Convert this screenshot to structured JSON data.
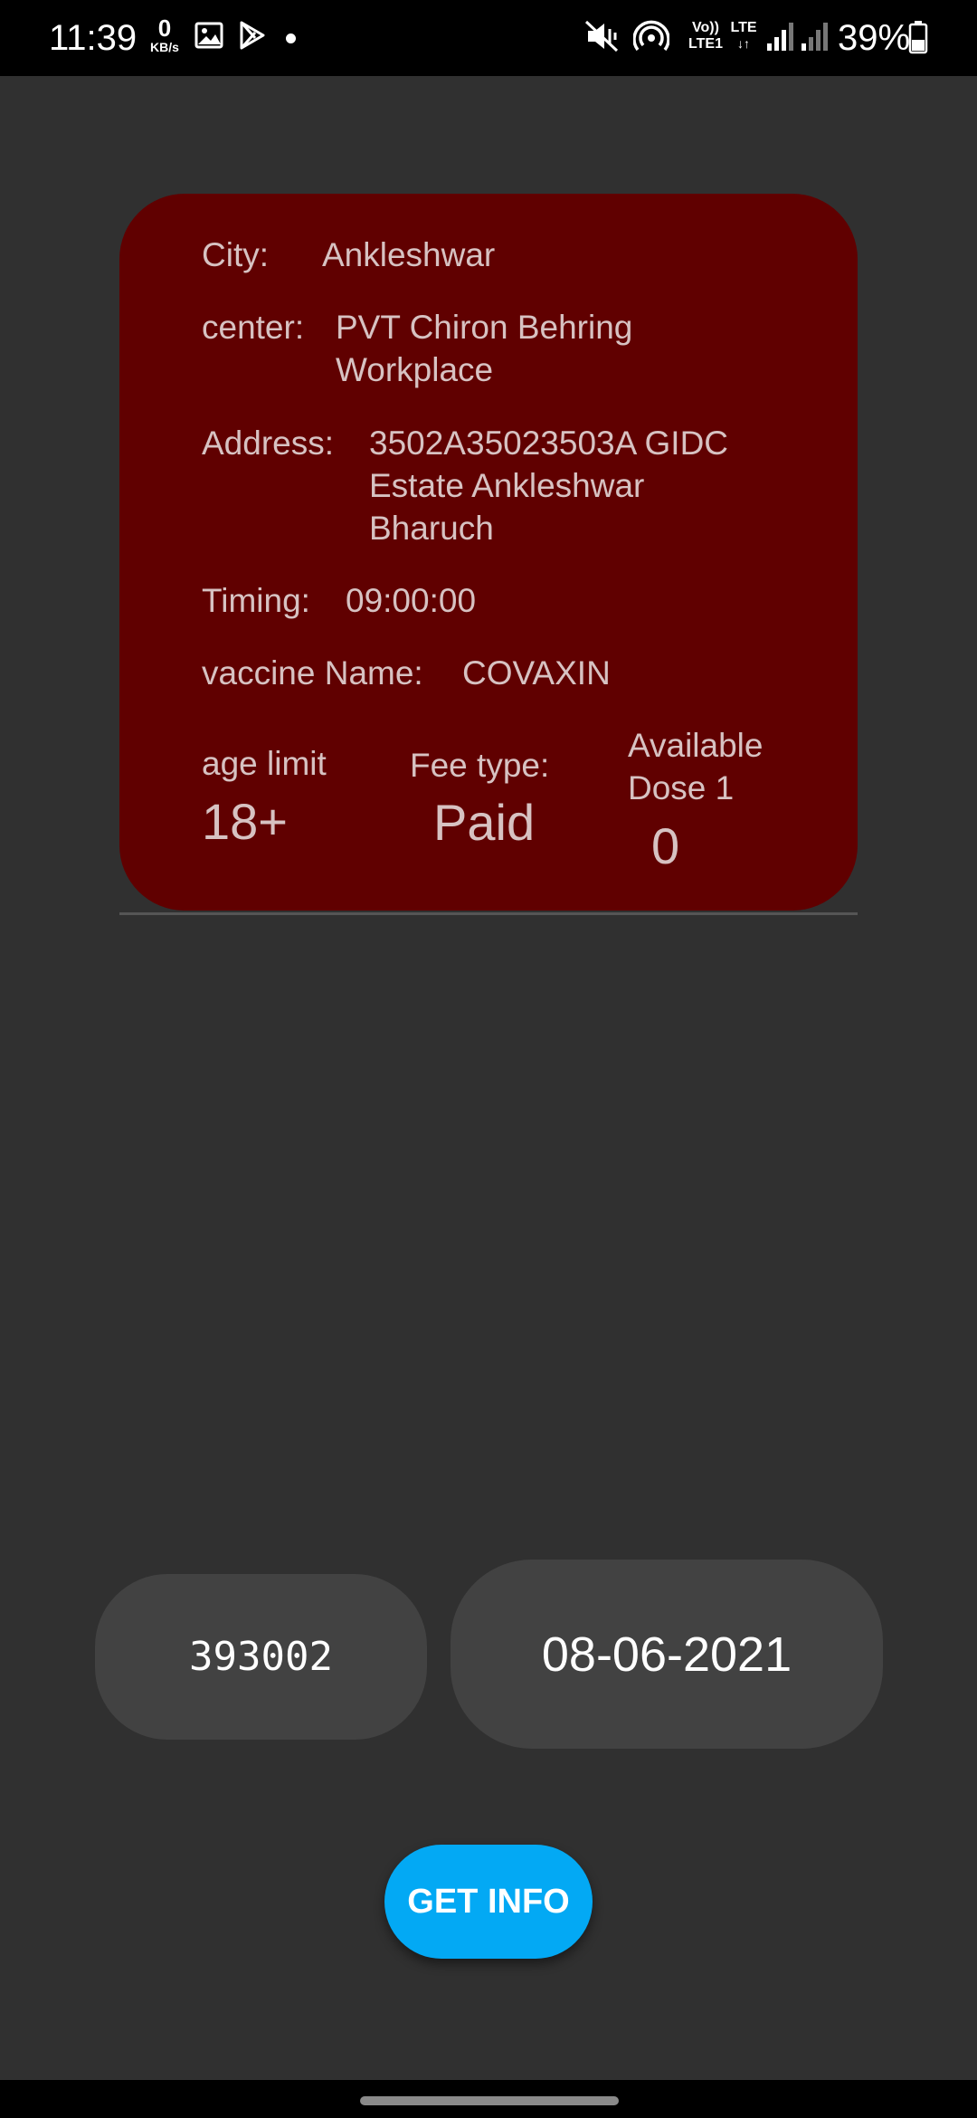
{
  "status_bar": {
    "time": "11:39",
    "net_speed_value": "0",
    "net_speed_unit": "KB/s",
    "volte_label": "Vo))",
    "lte1_label": "LTE1",
    "lte_label": "LTE",
    "battery_percent": "39%",
    "icons": [
      "gallery-icon",
      "play-store-icon",
      "notification-dot-icon",
      "mute-vibrate-icon",
      "hotspot-icon",
      "signal-icon",
      "signal-icon",
      "battery-icon"
    ]
  },
  "card": {
    "city_label": "City:",
    "city_value": "Ankleshwar",
    "center_label": "center:",
    "center_value_line1": "PVT Chiron Behring",
    "center_value_line2": "Workplace",
    "address_label": "Address:",
    "address_value_line1": "3502A35023503A GIDC",
    "address_value_line2": "Estate Ankleshwar",
    "address_value_line3": "Bharuch",
    "timing_label": "Timing:",
    "timing_value": "09:00:00",
    "vaccine_label": "vaccine Name:",
    "vaccine_value": "COVAXIN",
    "age_label": "age limit",
    "age_value": "18+",
    "fee_label": "Fee type:",
    "fee_value": "Paid",
    "dose_label_line1": "Available",
    "dose_label_line2": "Dose 1",
    "dose_value": "0"
  },
  "form": {
    "pincode_value": "393002",
    "date_value": "08-06-2021",
    "submit_label": "GET INFO"
  },
  "colors": {
    "background": "#303030",
    "card": "#600000",
    "card_text": "#d7c2c2",
    "input_bg": "#424242",
    "button": "#03a9f4"
  }
}
